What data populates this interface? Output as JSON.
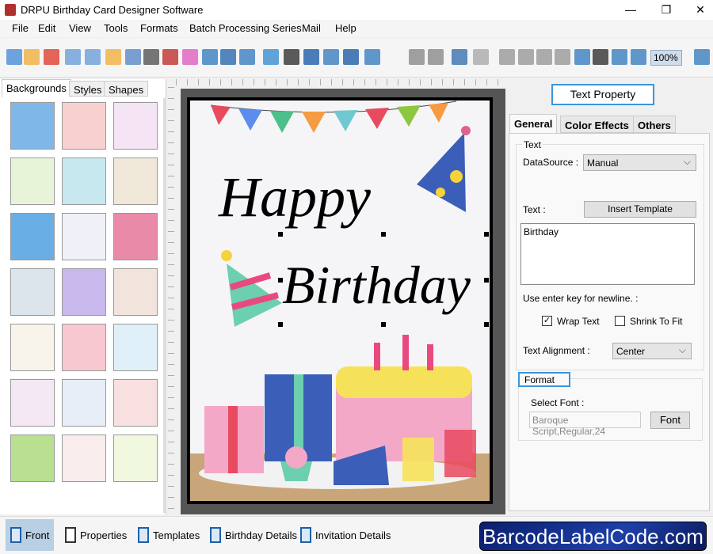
{
  "window": {
    "title": "DRPU Birthday Card Designer Software",
    "minimize": "—",
    "maximize": "❐",
    "close": "✕"
  },
  "menu": [
    "File",
    "Edit",
    "View",
    "Tools",
    "Formats",
    "Batch Processing Series",
    "Mail",
    "Help"
  ],
  "toolbar": {
    "zoom": "100%",
    "icons": [
      "new-icon",
      "open-icon",
      "close-icon",
      "save-icon",
      "save-as-icon",
      "export-icon",
      "properties-icon",
      "print-icon",
      "card-icon",
      "gift-icon",
      "image-icon",
      "pen-icon",
      "shapes-icon",
      "wordart-icon",
      "barcode-icon",
      "text-icon",
      "text-box-icon",
      "signature-icon",
      "mail-icon",
      "database-icon",
      "database2-icon",
      "undo-icon",
      "redo-icon",
      "copy-icon",
      "cut-icon",
      "paste-icon",
      "delete-icon",
      "grid-icon",
      "actual-size-icon",
      "fit-icon",
      "zoom-in-icon",
      "zoom-out-icon"
    ]
  },
  "left_tabs": [
    "Backgrounds",
    "Styles",
    "Shapes"
  ],
  "thumbnails": [
    "#7fb8e8",
    "#f8d0d0",
    "#f4e4f4",
    "#e8f4d8",
    "#c8e8f0",
    "#f0e8d8",
    "#6aaee6",
    "#f0f0f8",
    "#e88aa8",
    "#dce4ec",
    "#c8b8ec",
    "#f0e4dc",
    "#f8f4ec",
    "#f8c8d0",
    "#e0f0f8",
    "#f4e8f4",
    "#e8eef8",
    "#f8e0e0",
    "#b8e090",
    "#f8ecec",
    "#f0f8e0"
  ],
  "card": {
    "line1": "Happy",
    "line2": "Birthday"
  },
  "right": {
    "header": "Text Property",
    "tabs": [
      "General",
      "Color Effects",
      "Others"
    ],
    "text_group": "Text",
    "datasource_label": "DataSource :",
    "datasource_value": "Manual",
    "text_label": "Text :",
    "insert_template": "Insert Template",
    "text_value": "Birthday",
    "newline_hint": "Use enter key for newline. :",
    "wrap_text": "Wrap Text",
    "wrap_checked": true,
    "shrink_to_fit": "Shrink To Fit",
    "shrink_checked": false,
    "alignment_label": "Text Alignment :",
    "alignment_value": "Center",
    "format_group": "Format",
    "select_font_label": "Select Font :",
    "font_value": "Baroque Script,Regular,24",
    "font_button": "Font"
  },
  "bottom": {
    "tabs": [
      "Front",
      "Properties",
      "Templates",
      "Birthday Details",
      "Invitation Details"
    ],
    "logo": "BarcodeLabelCode.com"
  }
}
